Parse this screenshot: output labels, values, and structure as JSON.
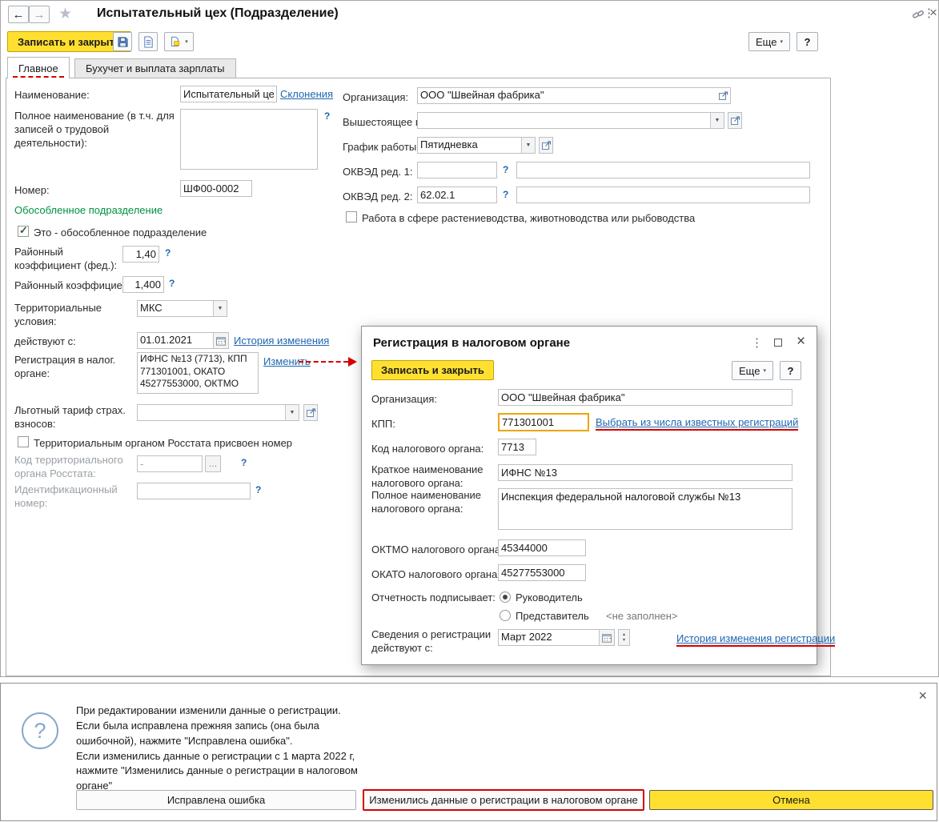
{
  "colors": {
    "accent_yellow": "#ffe030",
    "link_blue": "#2067b0",
    "section_green": "#00923f",
    "annotation_red": "#d60000"
  },
  "window": {
    "title": "Испытательный цех (Подразделение)",
    "toolbar": {
      "save_close": "Записать и закрыть",
      "more": "Еще",
      "help": "?"
    },
    "tabs": [
      {
        "label": "Главное",
        "active": true
      },
      {
        "label": "Бухучет и выплата зарплаты",
        "active": false
      }
    ]
  },
  "form": {
    "name": {
      "label": "Наименование:",
      "value": "Испытательный цех",
      "link": "Склонения"
    },
    "full_name": {
      "label": "Полное наименование (в т.ч. для записей о трудовой деятельности):",
      "value": ""
    },
    "number": {
      "label": "Номер:",
      "value": "ШФ00-0002"
    },
    "separate_section": {
      "heading": "Обособленное подразделение",
      "checkbox": "Это - обособленное подразделение",
      "checked": true
    },
    "coef_fed": {
      "label": "Районный коэффициент (фед.):",
      "value": "1,40"
    },
    "coef": {
      "label": "Районный коэффициент:",
      "value": "1,400"
    },
    "territory": {
      "label": "Территориальные условия:",
      "value": "МКС"
    },
    "valid_from": {
      "label": "действуют с:",
      "value": "01.01.2021",
      "link": "История изменения"
    },
    "tax_reg": {
      "label": "Регистрация в налог. органе:",
      "value": "ИФНС №13 (7713), КПП 771301001, ОКАТО 45277553000, ОКТМО",
      "link": "Изменить"
    },
    "preferential": {
      "label": "Льготный тариф страх. взносов:",
      "value": ""
    },
    "rosstat_checkbox": {
      "label": "Территориальным органом Росстата присвоен номер",
      "checked": false
    },
    "rosstat_code": {
      "label": "Код территориального органа Росстата:",
      "value": "-"
    },
    "id_number": {
      "label": "Идентификационный номер:",
      "value": ""
    },
    "organization": {
      "label": "Организация:",
      "value": "ООО \"Швейная фабрика\""
    },
    "parent_dept": {
      "label": "Вышестоящее подразд.:",
      "value": ""
    },
    "schedule": {
      "label": "График работы:",
      "value": "Пятидневка"
    },
    "okved1": {
      "label": "ОКВЭД ред. 1:",
      "value": "",
      "value2": ""
    },
    "okved2": {
      "label": "ОКВЭД ред. 2:",
      "value": "62.02.1",
      "value2": ""
    },
    "agriculture_checkbox": {
      "label": "Работа в сфере растениеводства, животноводства или рыбоводства",
      "checked": false
    }
  },
  "dialog": {
    "title": "Регистрация в налоговом органе",
    "toolbar": {
      "save_close": "Записать и закрыть",
      "more": "Еще",
      "help": "?"
    },
    "organization": {
      "label": "Организация:",
      "value": "ООО \"Швейная фабрика\""
    },
    "kpp": {
      "label": "КПП:",
      "value": "771301001",
      "link": "Выбрать из числа известных регистраций"
    },
    "tax_code": {
      "label": "Код налогового органа:",
      "value": "7713"
    },
    "short_name": {
      "label": "Краткое наименование налогового органа:",
      "value": "ИФНС №13"
    },
    "full_name": {
      "label": "Полное наименование налогового органа:",
      "value": "Инспекция федеральной налоговой службы №13"
    },
    "oktmo": {
      "label": "ОКТМО налогового органа:",
      "value": "45344000"
    },
    "okato": {
      "label": "ОКАТО налогового органа:",
      "value": "45277553000"
    },
    "signer": {
      "label": "Отчетность подписывает:",
      "option1": "Руководитель",
      "option2": "Представитель",
      "option2_hint": "<не заполнен>",
      "selected": "Руководитель"
    },
    "reg_from": {
      "label": "Сведения о регистрации действуют с:",
      "value": "Март 2022",
      "link": "История изменения регистрации"
    }
  },
  "notification": {
    "text": "При редактировании изменили данные о регистрации.\nЕсли была исправлена прежняя запись (она была\nошибочной), нажмите \"Исправлена ошибка\".\nЕсли изменились данные о регистрации с 1 марта 2022 г,\nнажмите \"Изменились данные о регистрации в налоговом\nоргане\"",
    "buttons": {
      "fixed_error": "Исправлена ошибка",
      "data_changed": "Изменились данные о регистрации в налоговом органе",
      "cancel": "Отмена"
    }
  }
}
